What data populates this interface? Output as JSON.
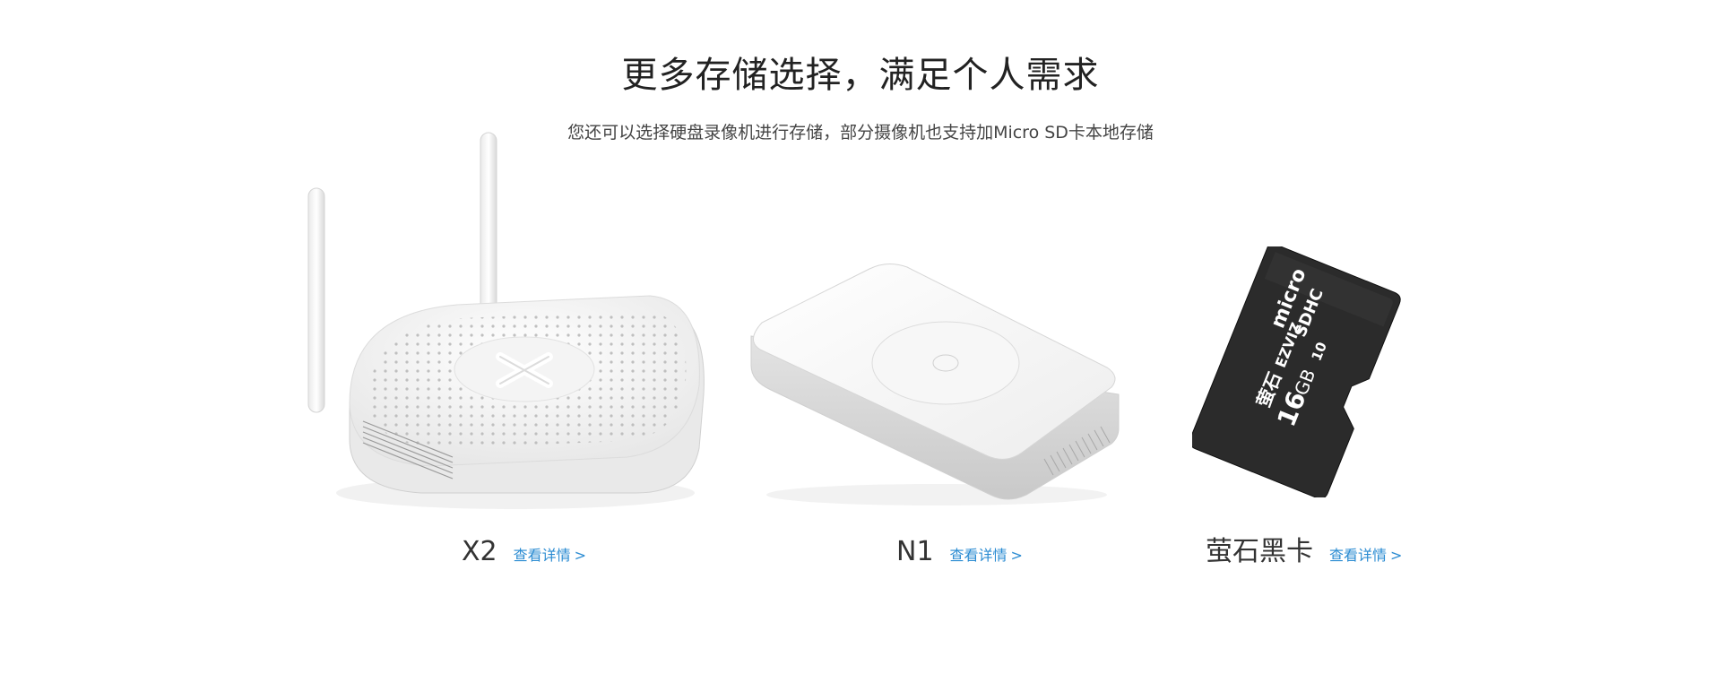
{
  "header": {
    "title": "更多存储选择，满足个人需求",
    "subtitle": "您还可以选择硬盘录像机进行存储，部分摄像机也支持加Micro SD卡本地存储"
  },
  "products": [
    {
      "name": "X2",
      "link_label": "查看详情",
      "link_chevron": ">",
      "image_icon": "router-x2-image"
    },
    {
      "name": "N1",
      "link_label": "查看详情",
      "link_chevron": ">",
      "image_icon": "nvr-n1-image"
    },
    {
      "name": "萤石黑卡",
      "link_label": "查看详情",
      "link_chevron": ">",
      "image_icon": "microsd-card-image",
      "card": {
        "brand_cn": "萤石",
        "brand_en": "EZVIZ",
        "capacity_num": "16",
        "capacity_unit": "GB",
        "speed_class": "10",
        "format": "micro",
        "format_sub": "SDHC"
      }
    }
  ],
  "colors": {
    "link": "#2a8bd2",
    "title": "#222222",
    "card_body": "#2b2b2b"
  }
}
